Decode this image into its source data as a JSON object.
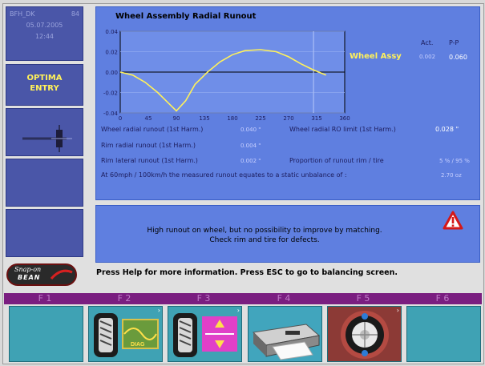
{
  "status": {
    "user": "BFH_DK",
    "code": "84",
    "date": "05.07.2005",
    "time": "12:44"
  },
  "mode": {
    "line1": "OPTIMA",
    "line2": "ENTRY"
  },
  "logo": {
    "line1": "Snap-on",
    "line2": "BEAN"
  },
  "panel": {
    "title": "Wheel Assembly Radial Runout",
    "legend": {
      "act": "Act.",
      "pp": "P-P",
      "label": "Wheel Assy",
      "act_value": "0.002",
      "pp_value": "0.060"
    }
  },
  "measurements": {
    "wheel_radial_label": "Wheel radial runout (1st Harm.)",
    "wheel_radial_value": "0.040 \"",
    "wheel_limit_label": "Wheel radial RO limit (1st Harm.)",
    "wheel_limit_value": "0.028 \"",
    "rim_radial_label": "Rim radial runout (1st Harm.)",
    "rim_radial_value": "0.004 \"",
    "rim_lateral_label": "Rim lateral runout (1st Harm.)",
    "rim_lateral_value": "0.002 \"",
    "proportion_label": "Proportion of runout rim / tire",
    "proportion_value": "5 % / 95 %",
    "unbalance_label": "At 60mph / 100km/h the measured runout equates to a static unbalance of :",
    "unbalance_value": "2.70 oz"
  },
  "message": {
    "line1": "High runout on wheel, but no possibility to improve by matching.",
    "line2": "Check rim and tire for defects."
  },
  "help": "Press Help for more information. Press ESC to go to balancing screen.",
  "fkeys": [
    {
      "label": "F 1",
      "icon": "empty"
    },
    {
      "label": "F 2",
      "icon": "tire-diag-icon",
      "badge": "DIAG"
    },
    {
      "label": "F 3",
      "icon": "tire-matching-icon"
    },
    {
      "label": "F 4",
      "icon": "printer-icon"
    },
    {
      "label": "F 5",
      "icon": "wheel-rotation-icon"
    },
    {
      "label": "F 6",
      "icon": "empty"
    }
  ],
  "colors": {
    "panel": "#5f7fe0",
    "sidebar": "#4a56a8",
    "accent": "#fff15a",
    "curve": "#fff15a",
    "fbar": "#7a1e80",
    "fkey": "#3fa2b4"
  },
  "chart_data": {
    "type": "line",
    "xlim": [
      0,
      360
    ],
    "ylim": [
      -0.04,
      0.04
    ],
    "xticks": [
      "0",
      "45",
      "90",
      "135",
      "180",
      "225",
      "270",
      "315",
      "360"
    ],
    "yticks": [
      "0.04",
      "0.02",
      "0.00",
      "-0.02",
      "-0.04"
    ],
    "cursor_x": 310,
    "series": [
      {
        "name": "Wheel Assy",
        "x": [
          0,
          20,
          40,
          60,
          80,
          90,
          105,
          120,
          140,
          160,
          180,
          200,
          225,
          250,
          270,
          290,
          310,
          330
        ],
        "y": [
          0.0,
          -0.003,
          -0.01,
          -0.02,
          -0.032,
          -0.038,
          -0.028,
          -0.012,
          0.0,
          0.01,
          0.017,
          0.021,
          0.022,
          0.02,
          0.015,
          0.008,
          0.002,
          -0.003
        ]
      }
    ]
  }
}
